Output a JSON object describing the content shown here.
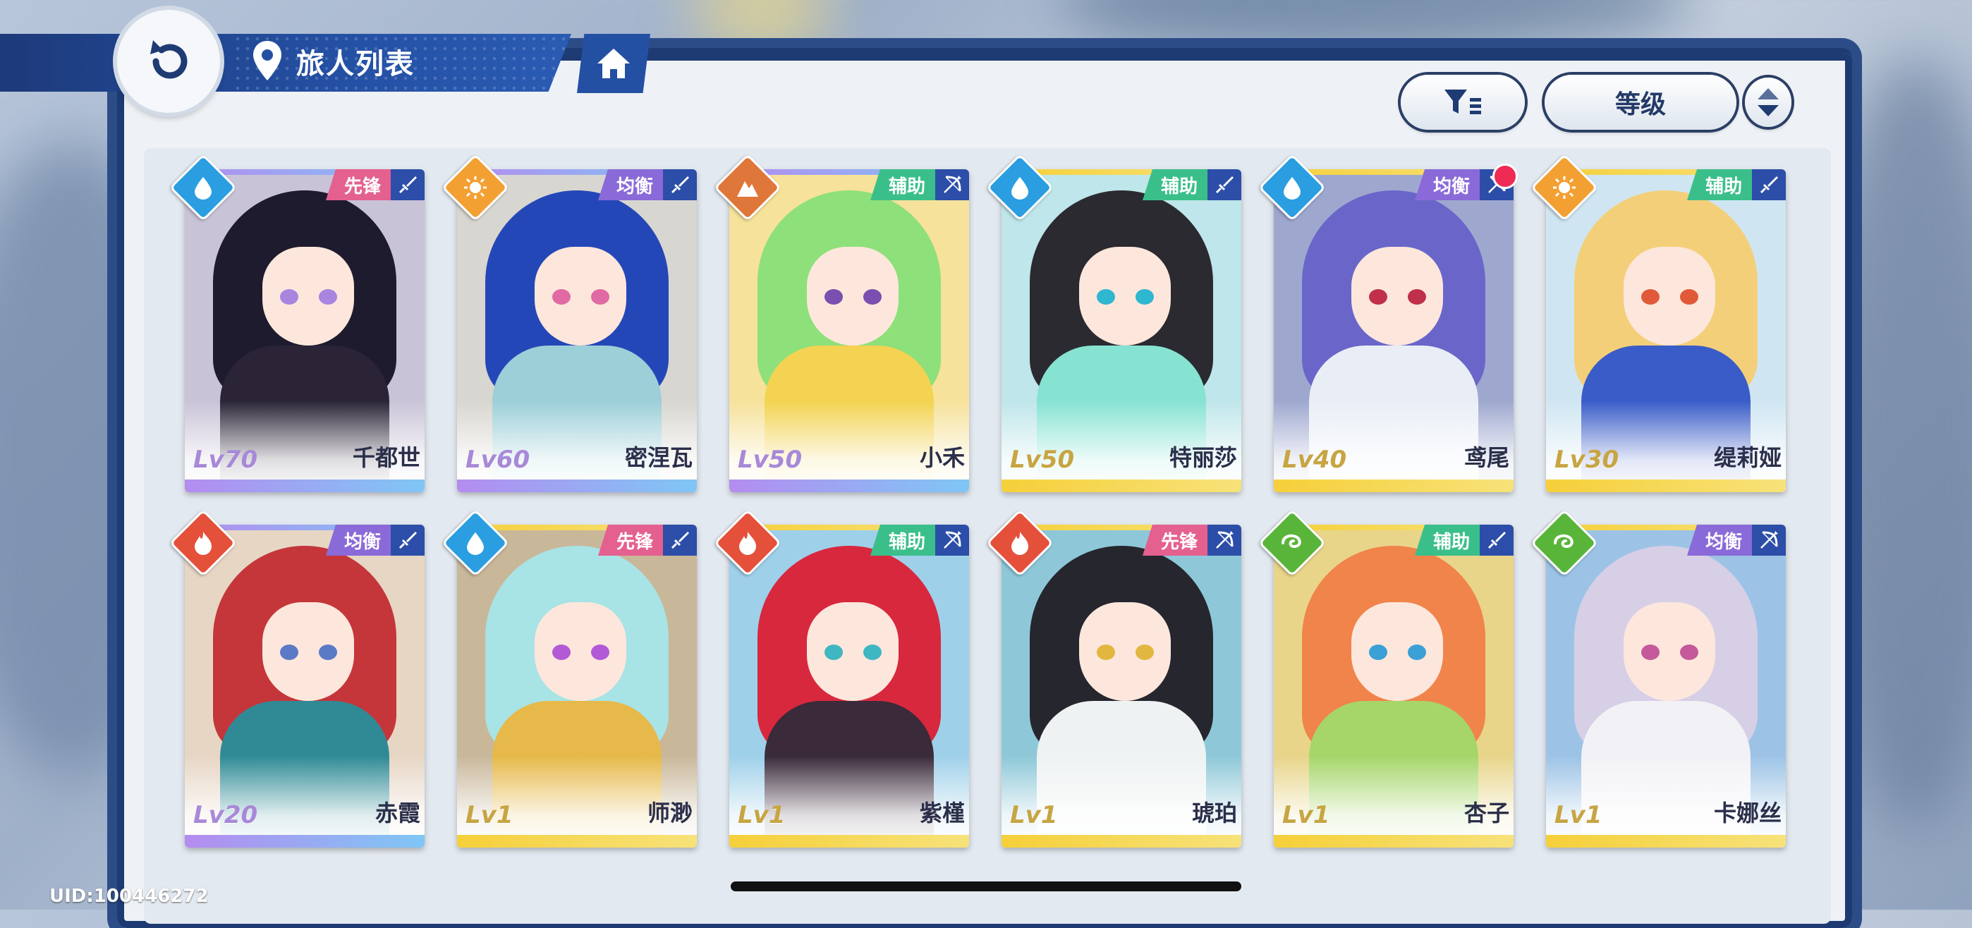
{
  "header": {
    "title": "旅人列表"
  },
  "controls": {
    "sort_label": "等级"
  },
  "characters": [
    {
      "name": "千都世",
      "level": "Lv70",
      "role": "先锋",
      "element": "water",
      "weapon": "sword",
      "role_color": "pink",
      "bar": "purple",
      "hair": "#1e1b2e",
      "outfit": "#2a2436",
      "eye": "#a985e0",
      "bg": "#c9c3d7",
      "notify": false
    },
    {
      "name": "密涅瓦",
      "level": "Lv60",
      "role": "均衡",
      "element": "sun",
      "weapon": "sword",
      "role_color": "purple",
      "bar": "purple",
      "hair": "#2447b8",
      "outfit": "#9ccfd8",
      "eye": "#e06aa4",
      "bg": "#d8d6d0",
      "notify": false
    },
    {
      "name": "小禾",
      "level": "Lv50",
      "role": "辅助",
      "element": "earth",
      "weapon": "bow",
      "role_color": "green",
      "bar": "purple",
      "hair": "#8ee07a",
      "outfit": "#f3d351",
      "eye": "#7a4fb0",
      "bg": "#f6e29a",
      "notify": false
    },
    {
      "name": "特丽莎",
      "level": "Lv50",
      "role": "辅助",
      "element": "water",
      "weapon": "sword",
      "role_color": "green",
      "bar": "gold",
      "hair": "#2a2a30",
      "outfit": "#86e3d2",
      "eye": "#2fb6d0",
      "bg": "#bfe6ea",
      "notify": false
    },
    {
      "name": "鸢尾",
      "level": "Lv40",
      "role": "均衡",
      "element": "water",
      "weapon": "bow",
      "role_color": "purple",
      "bar": "gold",
      "hair": "#6a66c9",
      "outfit": "#e9eef6",
      "eye": "#c0304a",
      "bg": "#9ea8cf",
      "notify": true
    },
    {
      "name": "缇莉娅",
      "level": "Lv30",
      "role": "辅助",
      "element": "sun",
      "weapon": "sword",
      "role_color": "green",
      "bar": "gold",
      "hair": "#f4cf7a",
      "outfit": "#3a5cc8",
      "eye": "#e05a3a",
      "bg": "#cfe6f2",
      "notify": false
    },
    {
      "name": "赤霞",
      "level": "Lv20",
      "role": "均衡",
      "element": "fire",
      "weapon": "sword",
      "role_color": "purple",
      "bar": "purple",
      "hair": "#c4363a",
      "outfit": "#2f8a96",
      "eye": "#5a7ac6",
      "bg": "#e7d6c4",
      "notify": false
    },
    {
      "name": "师渺",
      "level": "Lv1",
      "role": "先锋",
      "element": "water",
      "weapon": "sword",
      "role_color": "pink",
      "bar": "gold",
      "hair": "#a8e3e6",
      "outfit": "#e6b94a",
      "eye": "#b25ad6",
      "bg": "#c9b79a",
      "notify": false
    },
    {
      "name": "紫槿",
      "level": "Lv1",
      "role": "辅助",
      "element": "fire",
      "weapon": "bow",
      "role_color": "green",
      "bar": "gold",
      "hair": "#d8283e",
      "outfit": "#3a2a3a",
      "eye": "#3fb7c2",
      "bg": "#9fd0ea",
      "notify": false
    },
    {
      "name": "琥珀",
      "level": "Lv1",
      "role": "先锋",
      "element": "fire",
      "weapon": "bow",
      "role_color": "pink",
      "bar": "gold",
      "hair": "#26262e",
      "outfit": "#eef2f2",
      "eye": "#e2b640",
      "bg": "#8ec8d8",
      "notify": false
    },
    {
      "name": "杏子",
      "level": "Lv1",
      "role": "辅助",
      "element": "wind",
      "weapon": "sword",
      "role_color": "green",
      "bar": "gold",
      "hair": "#f0844a",
      "outfit": "#a6d66a",
      "eye": "#3aa0d6",
      "bg": "#e8d58a",
      "notify": false
    },
    {
      "name": "卡娜丝",
      "level": "Lv1",
      "role": "均衡",
      "element": "wind",
      "weapon": "bow",
      "role_color": "purple",
      "bar": "gold",
      "hair": "#d7cfe6",
      "outfit": "#f2f2f6",
      "eye": "#c45a9a",
      "bg": "#9cc3e6",
      "notify": false
    }
  ],
  "footer": {
    "uid": "UID:100446272"
  },
  "icons": {
    "back": "back-arrow-icon",
    "location": "location-pin-icon",
    "home": "home-icon",
    "filter": "filter-icon",
    "order": "sort-order-icon"
  }
}
